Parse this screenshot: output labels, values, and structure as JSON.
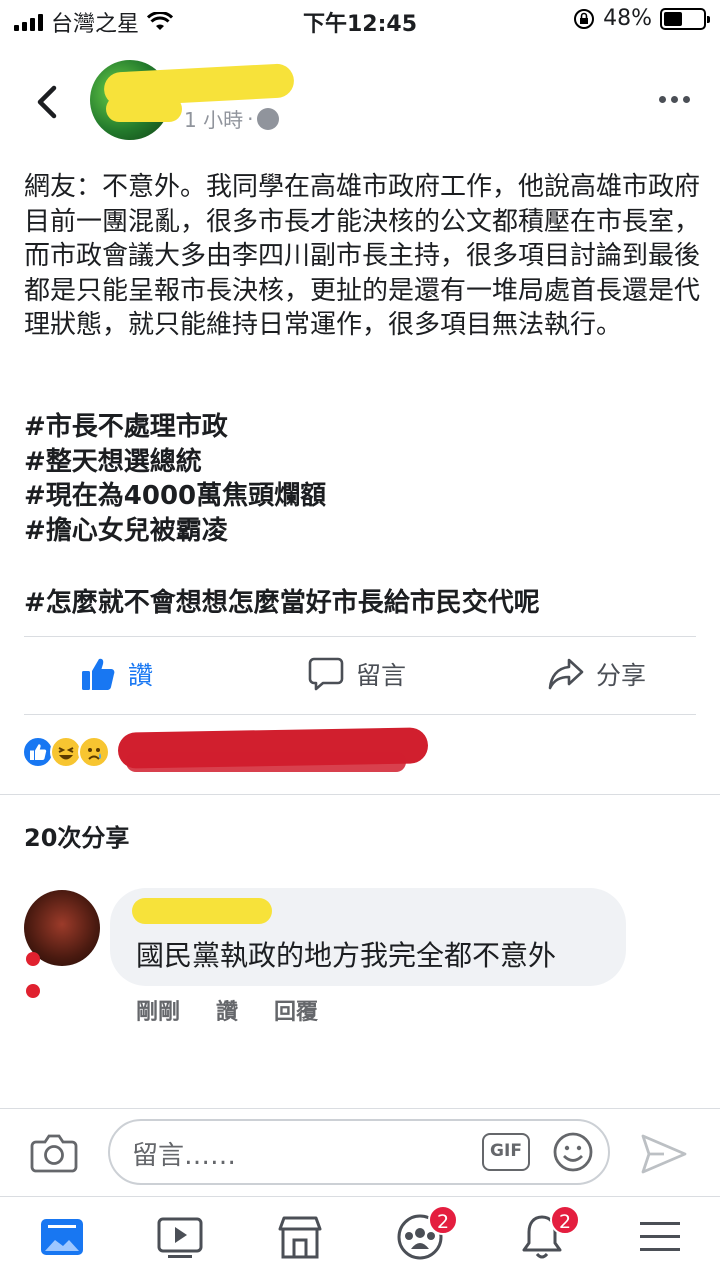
{
  "status_bar": {
    "carrier": "台灣之星",
    "time": "下午12:45",
    "battery": "48%",
    "battery_level": 0.48
  },
  "header": {
    "time_label": "1 小時",
    "separator": "·"
  },
  "post": {
    "text": "網友：不意外。我同學在高雄市政府工作，他說高雄市政府目前一團混亂，很多市長才能決核的公文都積壓在市長室，而市政會議大多由李四川副市長主持，很多項目討論到最後都是只能呈報市長決核，更扯的是還有一堆局處首長還是代理狀態，就只能維持日常運作，很多項目無法執行。",
    "hashtags": [
      "#市長不處理市政",
      "#整天想選總統",
      "#現在為4000萬焦頭爛額",
      "#擔心女兒被霸凌"
    ],
    "final_hashtag": "#怎麼就不會想想怎麼當好市長給市民交代呢"
  },
  "actions": {
    "like": "讚",
    "comment": "留言",
    "share": "分享"
  },
  "shares_count": "20次分享",
  "comment": {
    "text": "國民黨執政的地方我完全都不意外",
    "time": "剛剛",
    "like": "讚",
    "reply": "回覆"
  },
  "composer": {
    "placeholder": "留言……",
    "gif": "GIF"
  },
  "tabs": [
    {
      "name": "news-feed",
      "badge": ""
    },
    {
      "name": "watch",
      "badge": ""
    },
    {
      "name": "marketplace",
      "badge": ""
    },
    {
      "name": "groups",
      "badge": "2"
    },
    {
      "name": "notifications",
      "badge": "2"
    },
    {
      "name": "menu",
      "badge": ""
    }
  ],
  "colors": {
    "accent": "#1877f2",
    "redaction_yellow": "#f7e23a",
    "redaction_red": "#d11f2e",
    "badge": "#e41e3f"
  }
}
